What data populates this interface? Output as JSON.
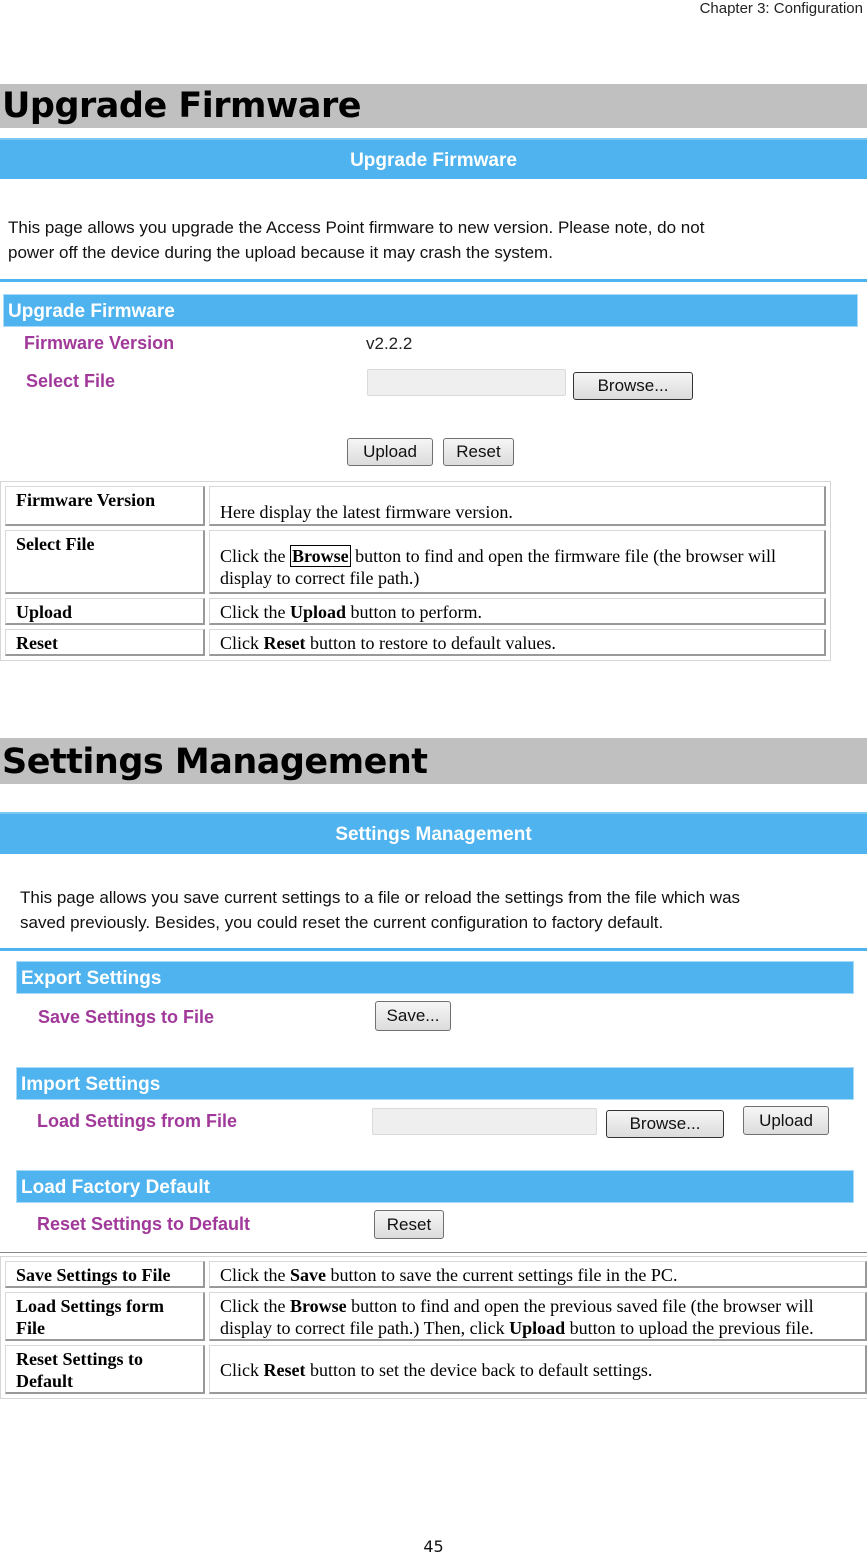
{
  "header": {
    "chapter": "Chapter 3: Configuration"
  },
  "upgrade": {
    "heading": "Upgrade Firmware",
    "screen": {
      "title": "Upgrade Firmware",
      "intro_line1": "This page allows you upgrade the Access Point firmware to new version. Please note, do not",
      "intro_line2": "power off the device during the upload because it may crash the system.",
      "section_title": "Upgrade Firmware",
      "firmware_version_label": "Firmware Version",
      "firmware_version_value": "v2.2.2",
      "select_file_label": "Select File",
      "select_file_value": "",
      "browse_label": "Browse...",
      "upload_label": "Upload",
      "reset_label": "Reset"
    },
    "table": [
      {
        "key": "Firmware Version",
        "pre": "Here display the latest firmware version.",
        "bold": "",
        "post": ""
      },
      {
        "key": "Select File",
        "pre": "Click the ",
        "bold": "Browse",
        "post": " button to find and open the firmware file (the browser will display to correct file path.)"
      },
      {
        "key": "Upload",
        "pre": "Click the ",
        "bold": "Upload",
        "post": " button to perform."
      },
      {
        "key": "Reset",
        "pre": "Click ",
        "bold": "Reset",
        "post": " button to restore to default values."
      }
    ]
  },
  "settings": {
    "heading": "Settings Management",
    "screen": {
      "title": "Settings Management",
      "intro_line1": "This page allows you save current settings to a file or reload the settings from the file which was",
      "intro_line2": "saved previously. Besides, you could reset the current configuration to factory default.",
      "export_title": "Export Settings",
      "save_label": "Save Settings to File",
      "save_button": "Save...",
      "import_title": "Import Settings",
      "load_label": "Load Settings from File",
      "load_value": "",
      "browse_button": "Browse...",
      "upload_button": "Upload",
      "factory_title": "Load Factory Default",
      "reset_label": "Reset Settings to Default",
      "reset_button": "Reset"
    },
    "table": [
      {
        "key": "Save Settings to File",
        "pre": "Click the ",
        "bold": "Save",
        "post": " button to save the current settings file in the PC.",
        "bold2": "",
        "post2": ""
      },
      {
        "key": "Load Settings form File",
        "pre": "Click the ",
        "bold": "Browse",
        "post": " button to find and open the previous saved file (the browser will display to correct file path.) Then, click ",
        "bold2": "Upload",
        "post2": " button to upload the previous file."
      },
      {
        "key": "Reset Settings to Default",
        "pre": "Click ",
        "bold": "Reset",
        "post": " button to set the device back to default settings.",
        "bold2": "",
        "post2": ""
      }
    ]
  },
  "footer": {
    "page_number": "45"
  },
  "colors": {
    "accent_blue": "#4eb3ee",
    "label_purple": "#a1399a",
    "heading_gray": "#c0c0c0"
  }
}
